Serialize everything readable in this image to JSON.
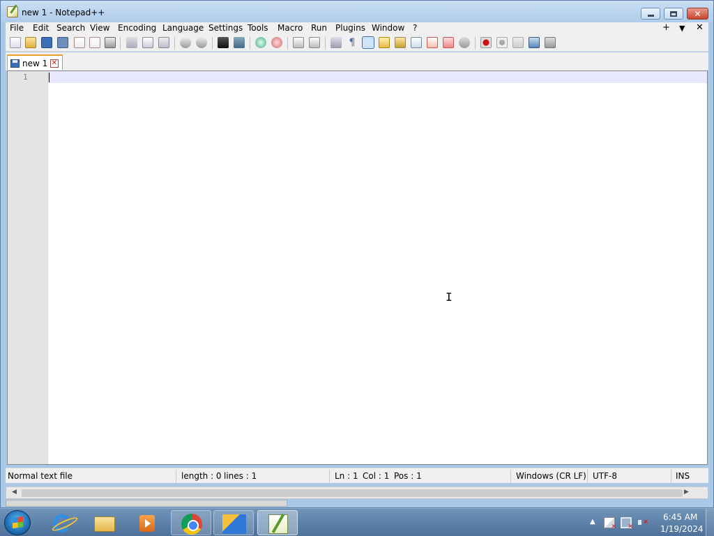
{
  "window": {
    "title": "new 1 - Notepad++"
  },
  "menubar": {
    "items": [
      "File",
      "Edit",
      "Search",
      "View",
      "Encoding",
      "Language",
      "Settings",
      "Tools",
      "Macro",
      "Run",
      "Plugins",
      "Window",
      "?"
    ],
    "right": [
      "+",
      "▼",
      "✕"
    ]
  },
  "toolbar": {
    "icons": [
      "new-file-icon",
      "open-file-icon",
      "save-icon",
      "save-all-icon",
      "close-icon",
      "close-all-icon",
      "print-icon",
      "cut-icon",
      "copy-icon",
      "paste-icon",
      "undo-icon",
      "redo-icon",
      "find-icon",
      "replace-icon",
      "zoom-in-icon",
      "zoom-out-icon",
      "sync-vertical-icon",
      "sync-horizontal-icon",
      "word-wrap-icon",
      "show-all-chars-icon",
      "indent-guide-icon",
      "user-defined-language-icon",
      "document-map-icon",
      "function-list-icon",
      "folder-as-workspace-icon",
      "monitoring-icon",
      "doc-switcher-icon",
      "record-macro-icon",
      "stop-recording-icon",
      "play-macro-icon",
      "run-macro-multiple-icon",
      "save-macro-icon"
    ]
  },
  "tabs": [
    {
      "label": "new 1",
      "close": "✕"
    }
  ],
  "editor": {
    "line_numbers": [
      "1"
    ],
    "ibeam": "I"
  },
  "status": {
    "file_type": "Normal text file",
    "length": "length : 0",
    "lines": "lines : 1",
    "ln": "Ln : 1",
    "col": "Col : 1",
    "pos": "Pos : 1",
    "eol": "Windows (CR LF)",
    "encoding": "UTF-8",
    "mode": "INS"
  },
  "scrollbar": {
    "left_arrow": "◀",
    "right_arrow": "▶"
  },
  "taskbar": {
    "apps": [
      "internet-explorer-icon",
      "file-explorer-icon",
      "media-player-icon",
      "chrome-icon",
      "app-icon",
      "notepad-plus-plus-icon"
    ],
    "tray_arrow": "▲",
    "clock_time": "6:45 AM",
    "clock_date": "1/19/2024"
  },
  "colors": {
    "accent_tab": "#f0a030",
    "current_line": "#e8e8ff",
    "record_macro": "#d01010"
  }
}
